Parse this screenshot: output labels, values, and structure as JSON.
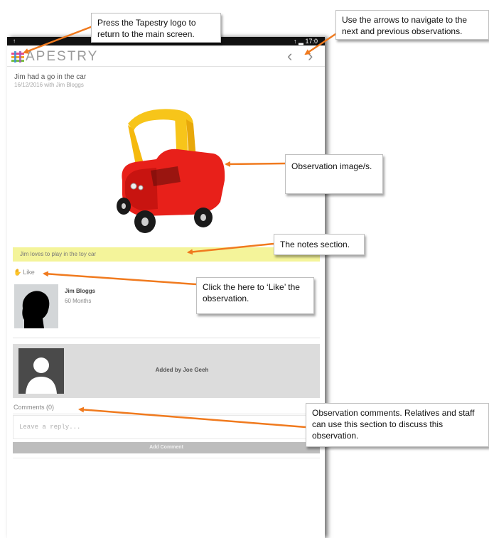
{
  "status_bar": {
    "signal": "↑",
    "right": "↑ ▂ 17:0"
  },
  "header": {
    "logo_text": "APESTRY",
    "prev_label": "‹",
    "next_label": "›"
  },
  "observation": {
    "title": "Jim had a go in the car",
    "meta": "16/12/2016 with Jim Bloggs",
    "notes": "Jim loves to play in the toy car",
    "like_icon": "✋",
    "like_label": "Like"
  },
  "child": {
    "name": "Jim Bloggs",
    "age": "60 Months"
  },
  "added_by": {
    "text": "Added by Joe Geeh"
  },
  "comments": {
    "label": "Comments (0)",
    "placeholder": "Leave a reply...",
    "button": "Add Comment"
  },
  "callouts": {
    "logo": "Press the Tapestry logo to return to the main screen.",
    "arrows": "Use the arrows to navigate to the next and previous observations.",
    "image": "Observation image/s.",
    "notes": "The notes section.",
    "like": "Click the here to ‘Like’ the observation.",
    "comments": "Observation comments. Relatives and staff can use this section to discuss this observation."
  },
  "colors": {
    "arrow": "#f07a1e",
    "notes_bg": "#f4f49a",
    "logo_stripes": [
      "#e84b8a",
      "#f5a623",
      "#7bc043",
      "#3b8fd6"
    ],
    "car_body": "#e8201a",
    "car_roof": "#f7c51a"
  },
  "icons": [
    "tapestry-logo-icon",
    "chevron-left-icon",
    "chevron-right-icon",
    "like-hand-icon",
    "child-silhouette-icon",
    "default-avatar-icon"
  ]
}
